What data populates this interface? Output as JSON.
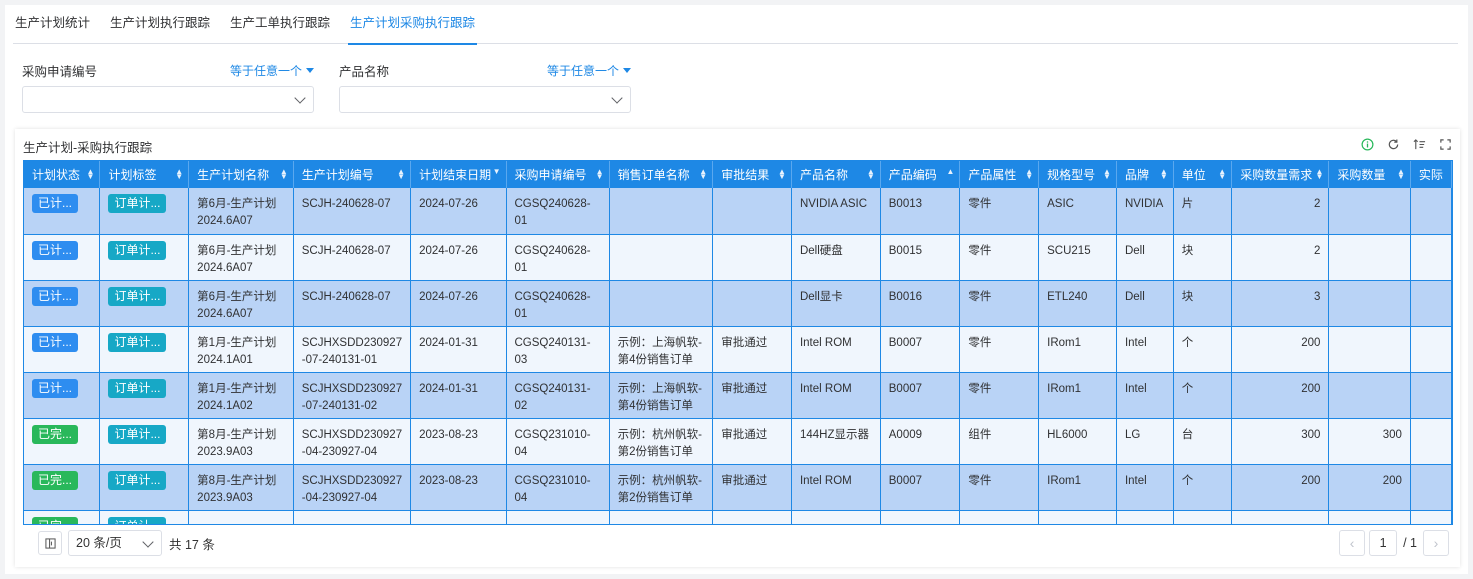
{
  "tabs": [
    {
      "label": "生产计划统计"
    },
    {
      "label": "生产计划执行跟踪"
    },
    {
      "label": "生产工单执行跟踪"
    },
    {
      "label": "生产计划采购执行跟踪",
      "active": true
    }
  ],
  "filters": [
    {
      "label": "采购申请编号",
      "operator": "等于任意一个",
      "value": ""
    },
    {
      "label": "产品名称",
      "operator": "等于任意一个",
      "value": ""
    }
  ],
  "panel": {
    "title": "生产计划-采购执行跟踪"
  },
  "toolbar_icons": [
    "info-icon",
    "refresh-icon",
    "sort-settings-icon",
    "fullscreen-icon"
  ],
  "table": {
    "columns": [
      "计划状态",
      "计划标签",
      "生产计划名称",
      "生产计划编号",
      "计划结束日期",
      "采购申请编号",
      "销售订单名称",
      "审批结果",
      "产品名称",
      "产品编码",
      "产品属性",
      "规格型号",
      "品牌",
      "单位",
      "采购数量需求",
      "采购数量",
      "实际"
    ],
    "rows": [
      {
        "status": "已计...",
        "status_color": "#2e8df0",
        "tag": "订单计...",
        "plan_name": "第6月-生产计划\n2024.6A07",
        "plan_no": "SCJH-240628-07",
        "end_date": "2024-07-26",
        "pr_no": "CGSQ240628-01",
        "so_name": "",
        "approval": "",
        "product": "NVIDIA ASIC",
        "code": "B0013",
        "attr": "零件",
        "spec": "ASIC",
        "brand": "NVIDIA",
        "unit": "片",
        "req_qty": "2",
        "pur_qty": "",
        "selected": true
      },
      {
        "status": "已计...",
        "status_color": "#2e8df0",
        "tag": "订单计...",
        "plan_name": "第6月-生产计划\n2024.6A07",
        "plan_no": "SCJH-240628-07",
        "end_date": "2024-07-26",
        "pr_no": "CGSQ240628-01",
        "so_name": "",
        "approval": "",
        "product": "Dell硬盘",
        "code": "B0015",
        "attr": "零件",
        "spec": "SCU215",
        "brand": "Dell",
        "unit": "块",
        "req_qty": "2",
        "pur_qty": "",
        "selected": false
      },
      {
        "status": "已计...",
        "status_color": "#2e8df0",
        "tag": "订单计...",
        "plan_name": "第6月-生产计划\n2024.6A07",
        "plan_no": "SCJH-240628-07",
        "end_date": "2024-07-26",
        "pr_no": "CGSQ240628-01",
        "so_name": "",
        "approval": "",
        "product": "Dell显卡",
        "code": "B0016",
        "attr": "零件",
        "spec": "ETL240",
        "brand": "Dell",
        "unit": "块",
        "req_qty": "3",
        "pur_qty": "",
        "selected": true
      },
      {
        "status": "已计...",
        "status_color": "#2e8df0",
        "tag": "订单计...",
        "plan_name": "第1月-生产计划\n2024.1A01",
        "plan_no": "SCJHXSDD230927\n-07-240131-01",
        "end_date": "2024-01-31",
        "pr_no": "CGSQ240131-03",
        "so_name": "示例：上海帆软-\n第4份销售订单",
        "approval": "审批通过",
        "product": "Intel ROM",
        "code": "B0007",
        "attr": "零件",
        "spec": "IRom1",
        "brand": "Intel",
        "unit": "个",
        "req_qty": "200",
        "pur_qty": "",
        "selected": false
      },
      {
        "status": "已计...",
        "status_color": "#2e8df0",
        "tag": "订单计...",
        "plan_name": "第1月-生产计划\n2024.1A02",
        "plan_no": "SCJHXSDD230927\n-07-240131-02",
        "end_date": "2024-01-31",
        "pr_no": "CGSQ240131-02",
        "so_name": "示例：上海帆软-\n第4份销售订单",
        "approval": "审批通过",
        "product": "Intel ROM",
        "code": "B0007",
        "attr": "零件",
        "spec": "IRom1",
        "brand": "Intel",
        "unit": "个",
        "req_qty": "200",
        "pur_qty": "",
        "selected": true
      },
      {
        "status": "已完...",
        "status_color": "#29b85b",
        "tag": "订单计...",
        "plan_name": "第8月-生产计划\n2023.9A03",
        "plan_no": "SCJHXSDD230927\n-04-230927-04",
        "end_date": "2023-08-23",
        "pr_no": "CGSQ231010-04",
        "so_name": "示例：杭州帆软-\n第2份销售订单",
        "approval": "审批通过",
        "product": "144HZ显示器",
        "code": "A0009",
        "attr": "组件",
        "spec": "HL6000",
        "brand": "LG",
        "unit": "台",
        "req_qty": "300",
        "pur_qty": "300",
        "selected": false
      },
      {
        "status": "已完...",
        "status_color": "#29b85b",
        "tag": "订单计...",
        "plan_name": "第8月-生产计划\n2023.9A03",
        "plan_no": "SCJHXSDD230927\n-04-230927-04",
        "end_date": "2023-08-23",
        "pr_no": "CGSQ231010-04",
        "so_name": "示例：杭州帆软-\n第2份销售订单",
        "approval": "审批通过",
        "product": "Intel ROM",
        "code": "B0007",
        "attr": "零件",
        "spec": "IRom1",
        "brand": "Intel",
        "unit": "个",
        "req_qty": "200",
        "pur_qty": "200",
        "selected": true
      },
      {
        "status": "已完...",
        "status_color": "#29b85b",
        "tag": "订单计...",
        "plan_name": "",
        "plan_no": "",
        "end_date": "",
        "pr_no": "",
        "so_name": "",
        "approval": "",
        "product": "",
        "code": "",
        "attr": "",
        "spec": "",
        "brand": "",
        "unit": "",
        "req_qty": "",
        "pur_qty": "",
        "selected": false
      }
    ]
  },
  "pager": {
    "page_size": "20 条/页",
    "total": "共 17 条",
    "current": "1",
    "of": "/ 1"
  },
  "colors": {
    "accent": "#1e88e5",
    "selected_row": "#b9d3f6",
    "status_blue": "#2e8df0",
    "status_green": "#29b85b",
    "tag_cyan": "#17a8c6"
  }
}
